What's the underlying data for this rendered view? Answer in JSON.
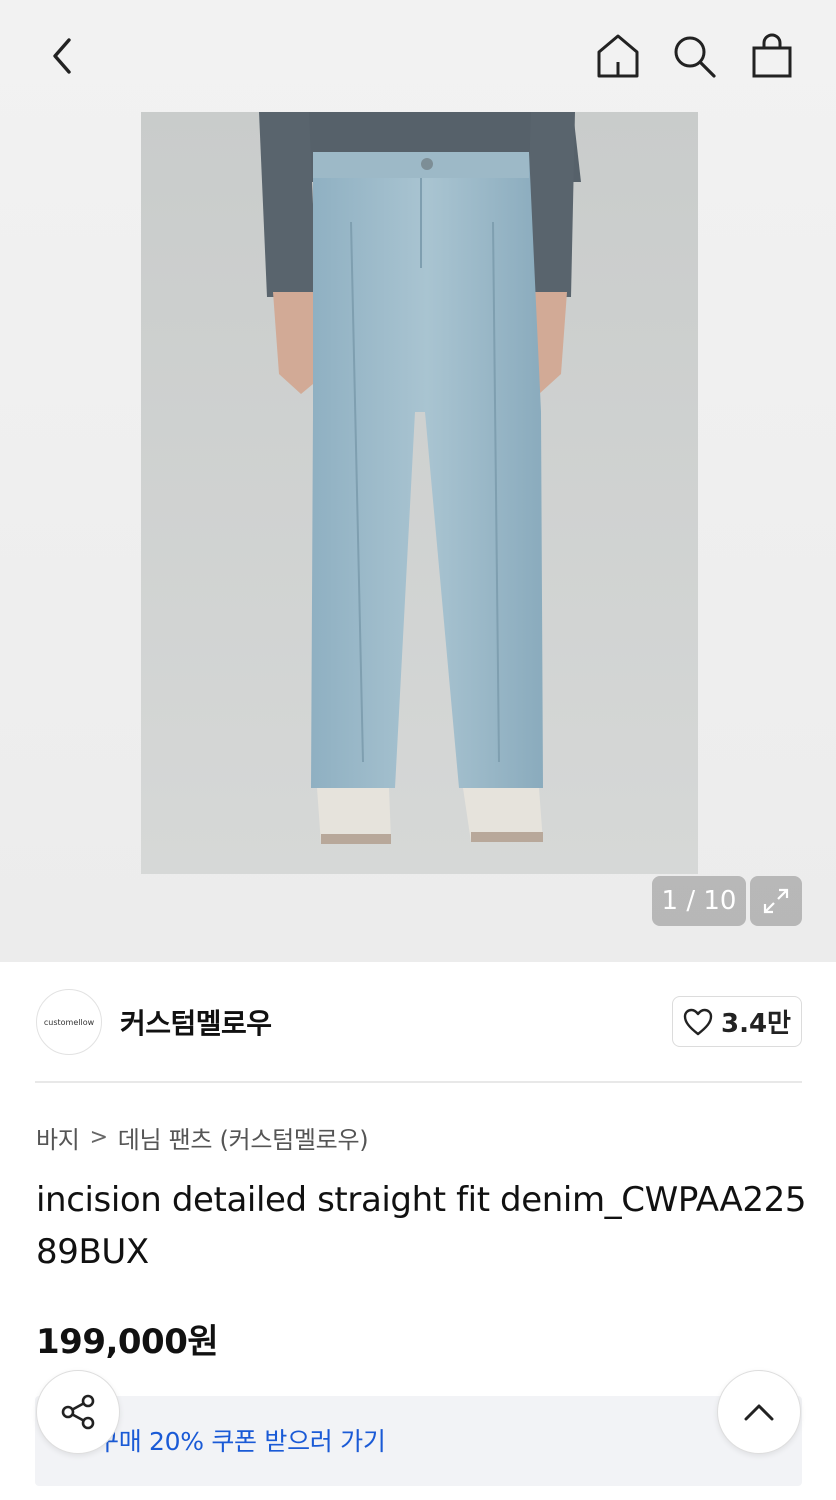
{
  "header": {
    "back_icon": "chevron-left-icon",
    "home_icon": "home-icon",
    "search_icon": "search-icon",
    "bag_icon": "shopping-bag-icon"
  },
  "gallery": {
    "counter": "1 / 10",
    "zoom_icon": "expand-icon"
  },
  "brand": {
    "logo_text": "customellow",
    "name": "커스텀멜로우",
    "like_count": "3.4만",
    "like_icon": "heart-icon"
  },
  "breadcrumb": {
    "level1": "바지",
    "separator": ">",
    "level2": "데님 팬츠 (커스텀멜로우)"
  },
  "product": {
    "title": "incision detailed straight fit denim_CWPAA22589BUX",
    "price": "199,000원"
  },
  "coupon": {
    "text": "구매 20% 쿠폰 받으러 가기"
  },
  "floating": {
    "share_icon": "share-icon",
    "scroll_top_icon": "chevron-up-icon"
  },
  "colors": {
    "accent_blue": "#1a5ad6",
    "text_dark": "#111111",
    "gallery_bg": "#efefef"
  }
}
